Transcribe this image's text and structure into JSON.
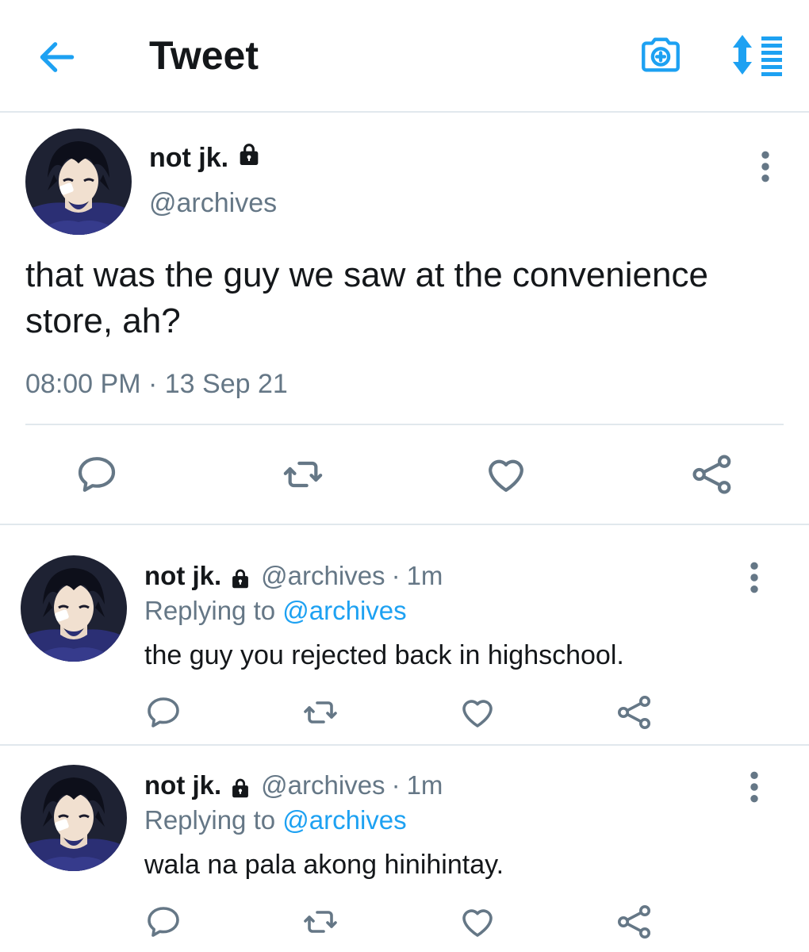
{
  "header": {
    "title": "Tweet",
    "back_icon": "arrow-left-icon",
    "camera_icon": "camera-plus-icon",
    "sort_icon": "sort-list-icon",
    "accent": "#1da1f2"
  },
  "main_tweet": {
    "name": "not jk.",
    "handle": "@archives",
    "text": "that was the guy we saw at the convenience store, ah?",
    "time": "08:00 PM",
    "separator": "·",
    "date": "13 Sep 21"
  },
  "replies": [
    {
      "name": "not jk.",
      "handle": "@archives",
      "separator": "·",
      "time": "1m",
      "replying_prefix": "Replying to ",
      "replying_to": "@archives",
      "text": "the guy you rejected back in highschool."
    },
    {
      "name": "not jk.",
      "handle": "@archives",
      "separator": "·",
      "time": "1m",
      "replying_prefix": "Replying to ",
      "replying_to": "@archives",
      "text": "wala na pala akong hinihintay."
    }
  ],
  "colors": {
    "text": "#14171a",
    "secondary": "#657786",
    "divider": "#e1e8ed",
    "accent": "#1da1f2"
  }
}
